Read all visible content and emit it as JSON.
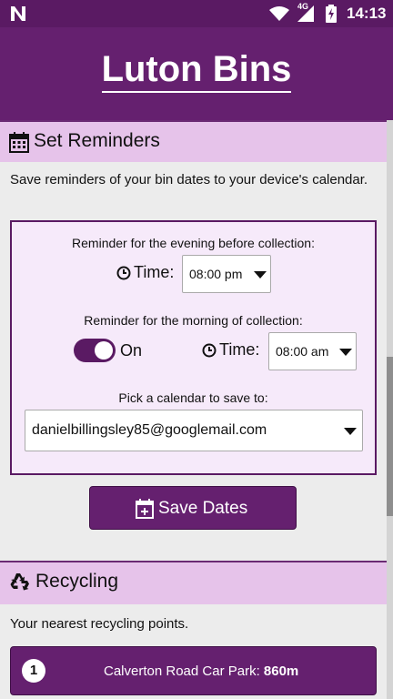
{
  "status_bar": {
    "network_type": "4G",
    "time": "14:13"
  },
  "header": {
    "title": "Luton Bins"
  },
  "reminders": {
    "section_title": "Set Reminders",
    "intro": "Save reminders of your bin dates to your device's calendar.",
    "evening_label": "Reminder for the evening before collection:",
    "time_label": "Time:",
    "evening_time": "08:00 pm",
    "morning_label": "Reminder for the morning of collection:",
    "morning_toggle_label": "On",
    "morning_time": "08:00 am",
    "calendar_label": "Pick a calendar to save to:",
    "calendar_value": "danielbillingsley85@googlemail.com",
    "save_button": "Save Dates"
  },
  "recycling": {
    "section_title": "Recycling",
    "intro": "Your nearest recycling points.",
    "points": [
      {
        "number": "1",
        "name": "Calverton Road Car Park: ",
        "distance": "860m"
      }
    ]
  },
  "colors": {
    "primary": "#65206f",
    "section_header": "#e6c3ea",
    "panel_bg": "#f6eafa",
    "page_bg": "#ececec"
  }
}
